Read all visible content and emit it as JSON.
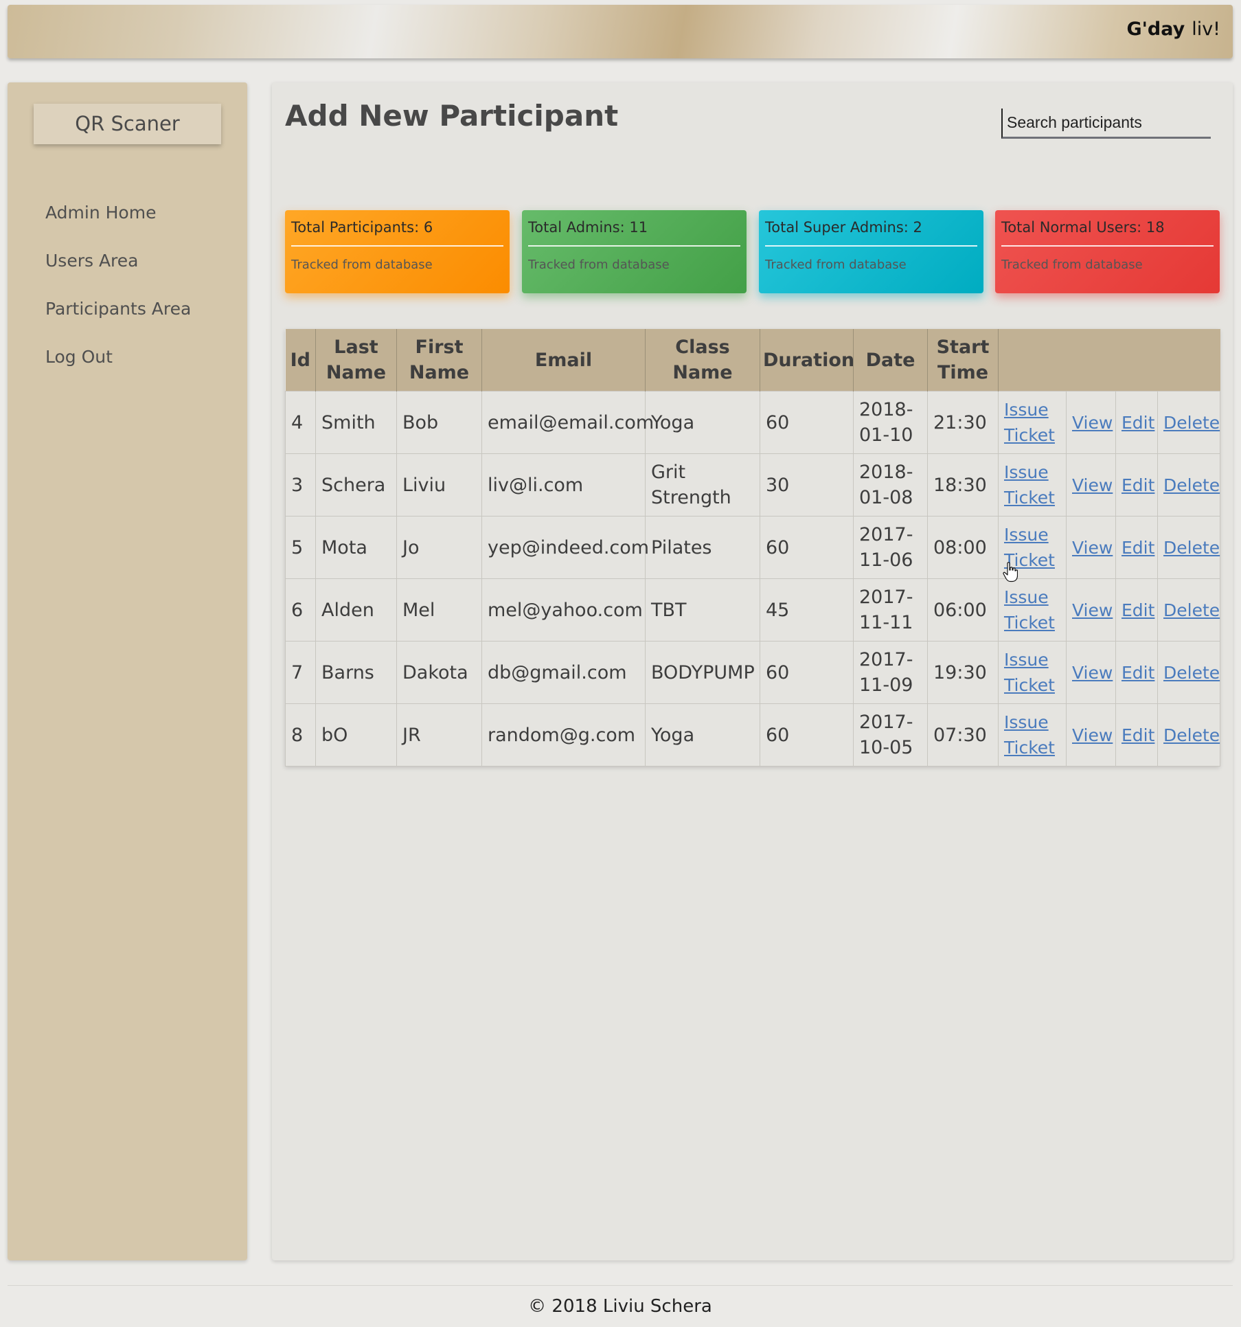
{
  "header": {
    "greeting": "G'day",
    "username": "liv!"
  },
  "sidebar": {
    "brand": "QR Scaner",
    "items": [
      {
        "label": "Admin Home"
      },
      {
        "label": "Users Area"
      },
      {
        "label": "Participants Area"
      },
      {
        "label": "Log Out"
      }
    ]
  },
  "main": {
    "title": "Add New Participant",
    "search_placeholder": "Search participants"
  },
  "cards": [
    {
      "title": "Total Participants: 6",
      "subtitle": "Tracked from database",
      "color": "#fb8c00"
    },
    {
      "title": "Total Admins: 11",
      "subtitle": "Tracked from database",
      "color": "#43a047"
    },
    {
      "title": "Total Super Admins: 2",
      "subtitle": "Tracked from database",
      "color": "#00acc1"
    },
    {
      "title": "Total Normal Users: 18",
      "subtitle": "Tracked from database",
      "color": "#e53935"
    }
  ],
  "table": {
    "headers": [
      "Id",
      "Last Name",
      "First Name",
      "Email",
      "Class Name",
      "Duration",
      "Date",
      "Start Time"
    ],
    "actions": {
      "issue_line1": "Issue",
      "issue_line2": "Ticket",
      "view": "View",
      "edit": "Edit",
      "delete": "Delete"
    },
    "rows": [
      {
        "id": "4",
        "last": "Smith",
        "first": "Bob",
        "email": "email@email.com",
        "class_name": "Yoga",
        "duration": "60",
        "date": "2018-01-10",
        "start": "21:30"
      },
      {
        "id": "3",
        "last": "Schera",
        "first": "Liviu",
        "email": "liv@li.com",
        "class_name": "Grit Strength",
        "duration": "30",
        "date": "2018-01-08",
        "start": "18:30"
      },
      {
        "id": "5",
        "last": "Mota",
        "first": "Jo",
        "email": "yep@indeed.com",
        "class_name": "Pilates",
        "duration": "60",
        "date": "2017-11-06",
        "start": "08:00"
      },
      {
        "id": "6",
        "last": "Alden",
        "first": "Mel",
        "email": "mel@yahoo.com",
        "class_name": "TBT",
        "duration": "45",
        "date": "2017-11-11",
        "start": "06:00"
      },
      {
        "id": "7",
        "last": "Barns",
        "first": "Dakota",
        "email": "db@gmail.com",
        "class_name": "BODYPUMP",
        "duration": "60",
        "date": "2017-11-09",
        "start": "19:30"
      },
      {
        "id": "8",
        "last": "bO",
        "first": "JR",
        "email": "random@g.com",
        "class_name": "Yoga",
        "duration": "60",
        "date": "2017-10-05",
        "start": "07:30"
      }
    ]
  },
  "footer": {
    "text": "© 2018 Liviu Schera"
  }
}
